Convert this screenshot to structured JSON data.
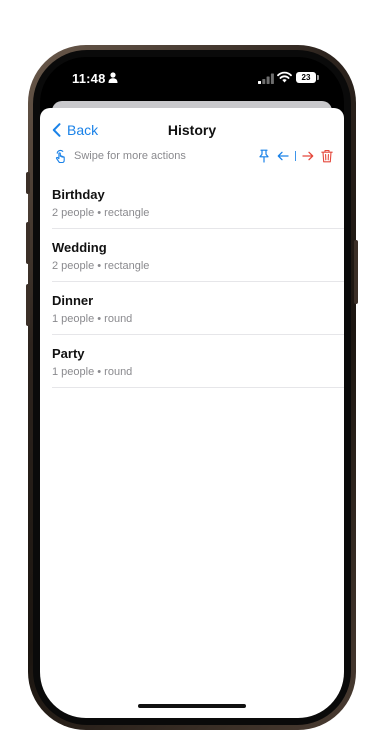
{
  "status_bar": {
    "time": "11:48",
    "battery": "23"
  },
  "nav": {
    "back_label": "Back",
    "title": "History"
  },
  "hint": {
    "text": "Swipe for more actions"
  },
  "icons": {
    "hint": "hand-tap-icon",
    "pin": "pin-icon",
    "prev": "arrow-left-icon",
    "next": "arrow-right-icon",
    "delete": "trash-icon"
  },
  "colors": {
    "accent": "#1a82e8",
    "destructive": "#e5483c",
    "secondary_text": "#8a8a8e"
  },
  "history": {
    "items": [
      {
        "title": "Birthday",
        "subtitle": "2 people • rectangle"
      },
      {
        "title": "Wedding",
        "subtitle": "2 people • rectangle"
      },
      {
        "title": "Dinner",
        "subtitle": "1 people • round"
      },
      {
        "title": "Party",
        "subtitle": "1 people • round"
      }
    ]
  }
}
